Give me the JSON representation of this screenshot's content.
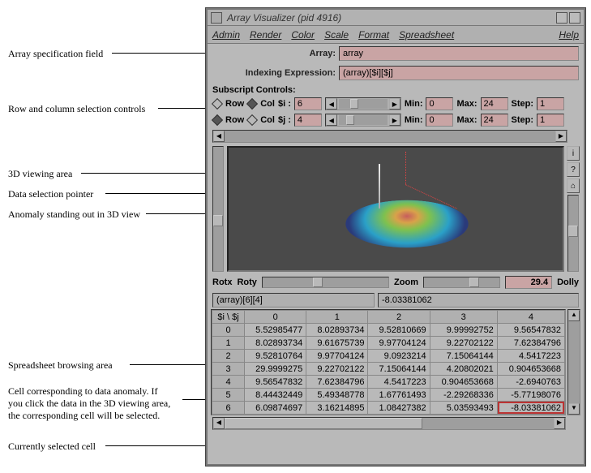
{
  "window": {
    "title": "Array Visualizer (pid 4916)"
  },
  "menubar": [
    "Admin",
    "Render",
    "Color",
    "Scale",
    "Format",
    "Spreadsheet"
  ],
  "menubar_right": "Help",
  "fields": {
    "array_label": "Array:",
    "array_value": "array",
    "index_label": "Indexing Expression:",
    "index_value": "(array)[$i][$j]"
  },
  "subscript": {
    "heading": "Subscript Controls:",
    "rows": [
      {
        "row_label": "Row",
        "col_label": "Col",
        "var": "$i :",
        "val": "6",
        "min_label": "Min:",
        "min": "0",
        "max_label": "Max:",
        "max": "24",
        "step_label": "Step:",
        "step": "1"
      },
      {
        "row_label": "Row",
        "col_label": "Col",
        "var": "$j :",
        "val": "4",
        "min_label": "Min:",
        "min": "0",
        "max_label": "Max:",
        "max": "24",
        "step_label": "Step:",
        "step": "1"
      }
    ]
  },
  "view": {
    "rotx_label": "Rotx",
    "roty_label": "Roty",
    "zoom_label": "Zoom",
    "zoom_value": "29.4",
    "dolly_label": "Dolly"
  },
  "selection": {
    "cell_expr": "(array)[6][4]",
    "cell_value": "-8.03381062"
  },
  "sheet": {
    "corner": "$i \\ $j",
    "cols": [
      "0",
      "1",
      "2",
      "3",
      "4"
    ],
    "rows": [
      "0",
      "1",
      "2",
      "3",
      "4",
      "5",
      "6"
    ],
    "data": [
      [
        "5.52985477",
        "8.02893734",
        "9.52810669",
        "9.99992752",
        "9.56547832"
      ],
      [
        "8.02893734",
        "9.61675739",
        "9.97704124",
        "9.22702122",
        "7.62384796"
      ],
      [
        "9.52810764",
        "9.97704124",
        "9.0923214",
        "7.15064144",
        "4.5417223"
      ],
      [
        "29.9999275",
        "9.22702122",
        "7.15064144",
        "4.20802021",
        "0.904653668"
      ],
      [
        "9.56547832",
        "7.62384796",
        "4.5417223",
        "0.904653668",
        "-2.6940763"
      ],
      [
        "8.44432449",
        "5.49348778",
        "1.67761493",
        "-2.29268336",
        "-5.77198076"
      ],
      [
        "6.09874697",
        "3.16214895",
        "1.08427382",
        "5.03593493",
        "-8.03381062"
      ]
    ],
    "current": {
      "r": 6,
      "c": 4
    }
  },
  "annotations": {
    "array_spec": "Array specification field",
    "rowcol": "Row and column selection controls",
    "view3d": "3D viewing area",
    "pointer": "Data selection pointer",
    "anomaly3d": "Anomaly standing out in 3D view",
    "spreadsheet": "Spreadsheet browsing area",
    "anomalycell": "Cell corresponding to data anomaly. If\nyou click the data in the 3D viewing area,\nthe corresponding cell will be selected.",
    "current": "Currently selected cell"
  }
}
